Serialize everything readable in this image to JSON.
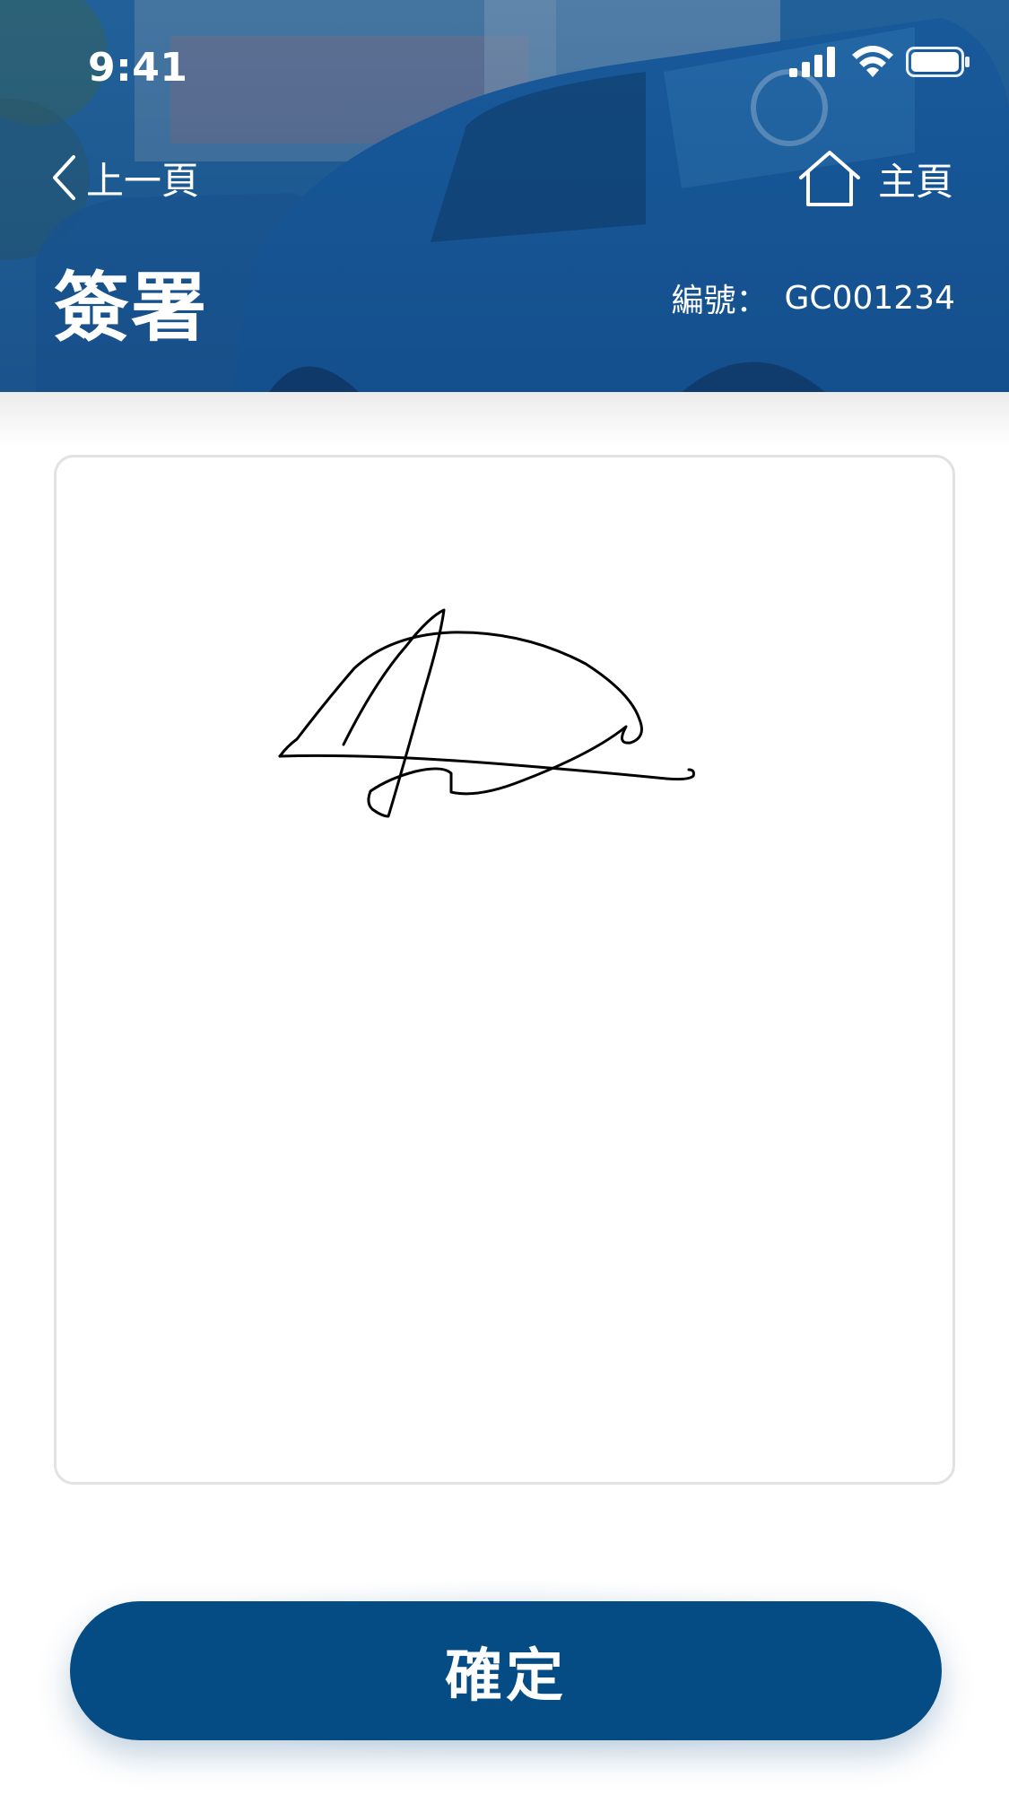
{
  "status_bar": {
    "time": "9:41",
    "icons": [
      "signal-icon",
      "wifi-icon",
      "battery-icon"
    ]
  },
  "header": {
    "back_label": "上一頁",
    "back_icon": "chevron-left-icon",
    "home_label": "主頁",
    "home_icon": "home-icon",
    "title": "簽署",
    "order_label": "編號：",
    "order_value": "GC001234"
  },
  "signature_pad": {
    "has_signature": true
  },
  "confirm_button": {
    "label": "確定"
  },
  "colors": {
    "primary": "#064c84",
    "header_blue": "#1f5f98",
    "pad_border": "#e2e2e2",
    "background": "#ffffff",
    "ink": "#000000"
  }
}
